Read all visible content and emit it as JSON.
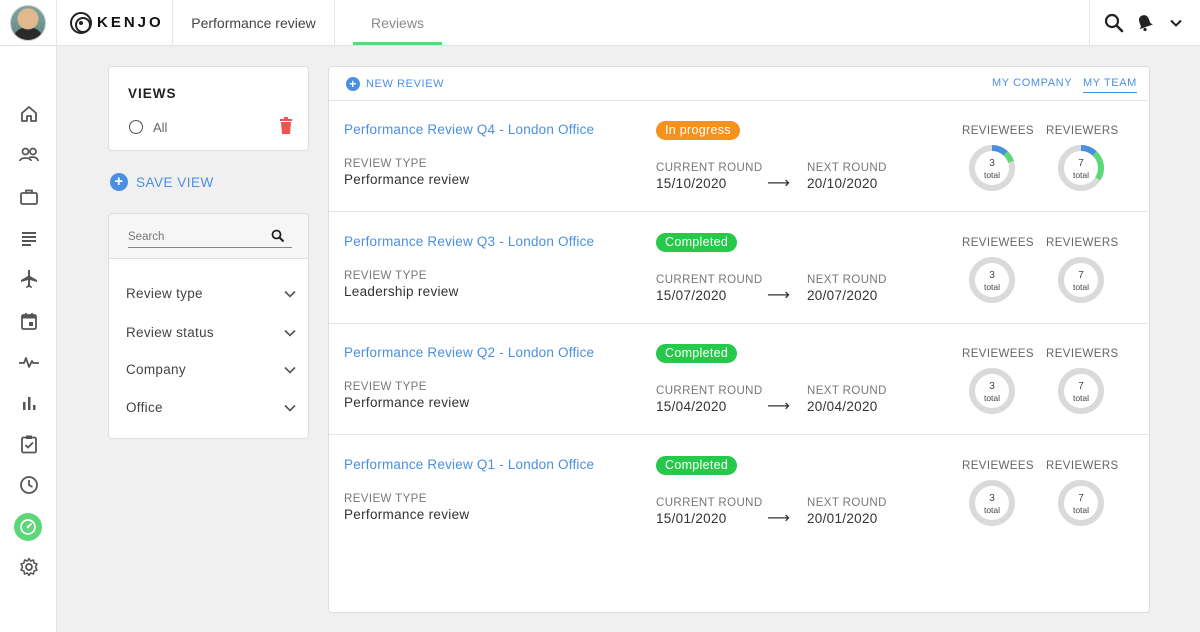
{
  "topbar": {
    "logo_text": "KENJO",
    "tab_performance": "Performance review",
    "tab_reviews": "Reviews"
  },
  "sidebar": {
    "icons": [
      "home-icon",
      "people-icon",
      "briefcase-icon",
      "list-icon",
      "plane-icon",
      "calendar-icon",
      "pulse-icon",
      "bar-chart-icon",
      "clipboard-check-icon",
      "clock-icon",
      "gauge-icon",
      "gear-icon"
    ]
  },
  "views": {
    "title": "VIEWS",
    "option_all": "All",
    "save_view": "SAVE VIEW"
  },
  "search": {
    "placeholder": "Search"
  },
  "filters": [
    "Review type",
    "Review status",
    "Company",
    "Office"
  ],
  "main": {
    "new_review": "NEW REVIEW",
    "scope_company": "MY COMPANY",
    "scope_team": "MY TEAM"
  },
  "labels": {
    "review_type": "REVIEW TYPE",
    "current_round": "CURRENT ROUND",
    "next_round": "NEXT ROUND",
    "reviewees": "REVIEWEES",
    "reviewers": "REVIEWERS",
    "total": "total",
    "arrow": "⟶"
  },
  "colors": {
    "accent_blue": "#4a90e2",
    "green": "#5dd878",
    "orange": "#f5921e",
    "trash_red": "#f0544f"
  },
  "reviews": [
    {
      "title": "Performance Review Q4 - London Office",
      "status": "In progress",
      "status_color": "#f5921e",
      "review_type": "Performance review",
      "current_round": "15/10/2020",
      "next_round": "20/10/2020",
      "reviewees": "3",
      "reviewers": "7",
      "reviewees_progress": {
        "blue": 0.12,
        "green": 0.08
      },
      "reviewers_progress": {
        "blue": 0.12,
        "green": 0.22
      }
    },
    {
      "title": "Performance Review Q3 - London Office",
      "status": "Completed",
      "status_color": "#27c94a",
      "review_type": "Leadership review",
      "current_round": "15/07/2020",
      "next_round": "20/07/2020",
      "reviewees": "3",
      "reviewers": "7",
      "reviewees_progress": {
        "blue": 0,
        "green": 0
      },
      "reviewers_progress": {
        "blue": 0,
        "green": 0
      }
    },
    {
      "title": "Performance Review Q2 - London Office",
      "status": "Completed",
      "status_color": "#27c94a",
      "review_type": "Performance review",
      "current_round": "15/04/2020",
      "next_round": "20/04/2020",
      "reviewees": "3",
      "reviewers": "7",
      "reviewees_progress": {
        "blue": 0,
        "green": 0
      },
      "reviewers_progress": {
        "blue": 0,
        "green": 0
      }
    },
    {
      "title": "Performance Review Q1 - London Office",
      "status": "Completed",
      "status_color": "#27c94a",
      "review_type": "Performance review",
      "current_round": "15/01/2020",
      "next_round": "20/01/2020",
      "reviewees": "3",
      "reviewers": "7",
      "reviewees_progress": {
        "blue": 0,
        "green": 0
      },
      "reviewers_progress": {
        "blue": 0,
        "green": 0
      }
    }
  ]
}
